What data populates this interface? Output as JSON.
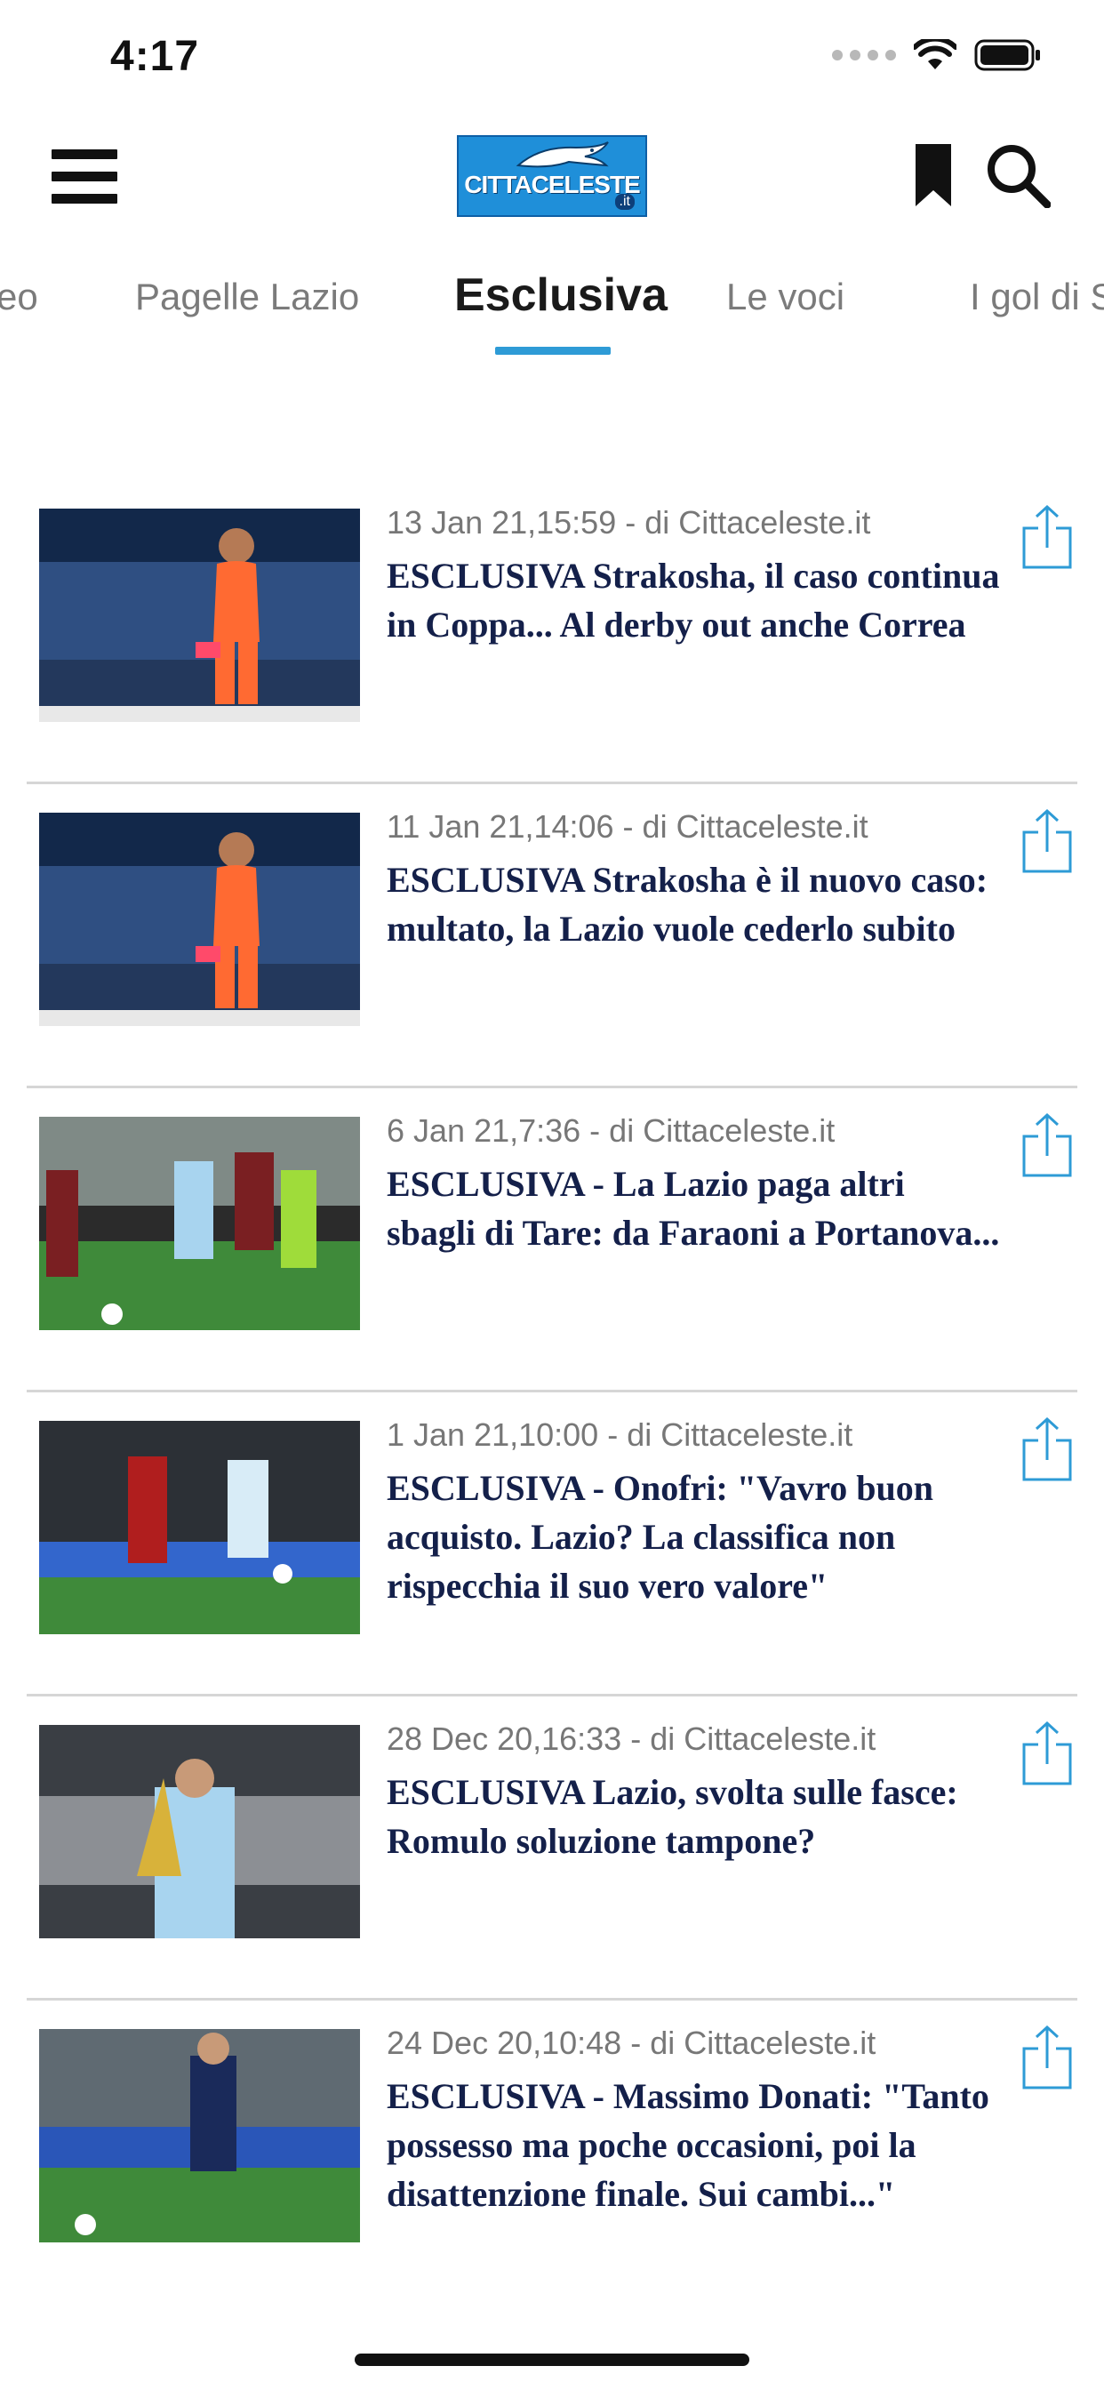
{
  "status": {
    "time": "4:17"
  },
  "brand": {
    "logo_text": "CITTACELESTE",
    "logo_sub": ".it"
  },
  "tabs": [
    {
      "label": "eo"
    },
    {
      "label": "Pagelle Lazio"
    },
    {
      "label": "Esclusiva"
    },
    {
      "label": "Le voci"
    },
    {
      "label": "I gol di S"
    }
  ],
  "articles": [
    {
      "meta": "13 Jan 21,15:59 - di Cittaceleste.it",
      "title": "ESCLUSIVA Strakosha, il caso continua in Coppa... Al derby out anche Correa"
    },
    {
      "meta": "11 Jan 21,14:06 - di Cittaceleste.it",
      "title": "ESCLUSIVA Strakosha è il nuovo caso: multato, la Lazio vuole cederlo subito"
    },
    {
      "meta": "6 Jan 21,7:36 - di Cittaceleste.it",
      "title": "ESCLUSIVA - La Lazio paga altri sbagli di Tare: da Faraoni a Portanova..."
    },
    {
      "meta": "1 Jan 21,10:00 - di Cittaceleste.it",
      "title": "ESCLUSIVA - Onofri: \"Vavro buon acquisto. Lazio? La classifica non rispecchia il suo vero valore\""
    },
    {
      "meta": "28 Dec 20,16:33 - di Cittaceleste.it",
      "title": "ESCLUSIVA Lazio, svolta sulle fasce: Romulo soluzione tampone?"
    },
    {
      "meta": "24 Dec 20,10:48 - di Cittaceleste.it",
      "title": "ESCLUSIVA - Massimo Donati: \"Tanto possesso ma poche occasioni, poi la disattenzione finale. Sui cambi...\""
    }
  ],
  "colors": {
    "accent": "#2e9bd6",
    "headline": "#14204a",
    "meta": "#777777"
  },
  "icons": [
    "menu-icon",
    "bookmark-icon",
    "search-icon",
    "share-icon",
    "wifi-icon",
    "battery-icon"
  ]
}
